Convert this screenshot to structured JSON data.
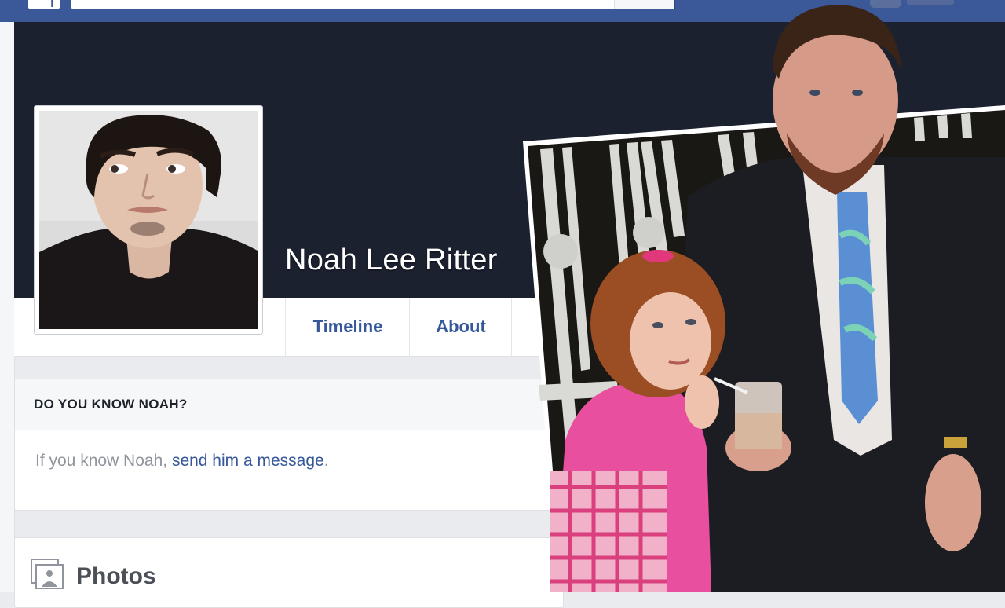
{
  "profile": {
    "name": "Noah Lee Ritter"
  },
  "tabs": {
    "timeline": "Timeline",
    "about": "About"
  },
  "know_card": {
    "heading": "DO YOU KNOW NOAH?",
    "body_prefix": "If you know Noah, ",
    "link_text": "send him a message",
    "body_suffix": "."
  },
  "photos": {
    "title": "Photos"
  },
  "colors": {
    "brand_blue": "#3b5998",
    "link_blue": "#365899",
    "cover_dark": "#1c2130",
    "page_bg": "#e9ebee"
  },
  "icons": {
    "logo": "facebook-logo",
    "photos": "photos-icon"
  }
}
